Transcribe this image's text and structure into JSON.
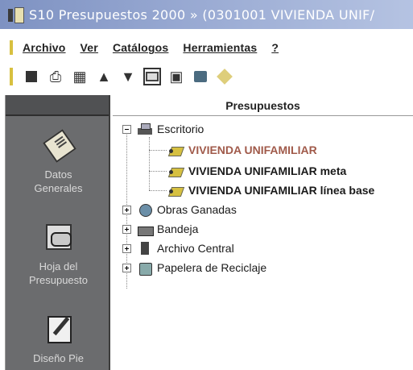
{
  "window": {
    "title": "S10 Presupuestos 2000 » (0301001 VIVIENDA UNIF/"
  },
  "menubar": {
    "items": [
      "Archivo",
      "Ver",
      "Catálogos",
      "Herramientas",
      "?"
    ]
  },
  "toolbar": {
    "buttons": [
      "save-icon",
      "print-icon",
      "print-preview-icon",
      "up-arrow-icon",
      "down-arrow-icon",
      "view-icon",
      "tile-icon",
      "calculator-icon",
      "tag-icon"
    ]
  },
  "sidebar": {
    "items": [
      {
        "label_line1": "Datos",
        "label_line2": "Generales",
        "icon": "notepad-icon"
      },
      {
        "label_line1": "Hoja del",
        "label_line2": "Presupuesto",
        "icon": "hand-sheet-icon"
      },
      {
        "label_line1": "Diseño Pie",
        "label_line2": "",
        "icon": "pencil-icon"
      }
    ]
  },
  "main": {
    "header": "Presupuestos",
    "tree": {
      "escritorio": "Escritorio",
      "children": [
        "VIVIENDA UNIFAMILIAR",
        "VIVIENDA UNIFAMILIAR meta",
        "VIVIENDA UNIFAMILIAR línea base"
      ],
      "obras": "Obras Ganadas",
      "bandeja": "Bandeja",
      "archivo": "Archivo Central",
      "papelera": "Papelera de Reciclaje"
    }
  },
  "colors": {
    "titlebar": "#8ea0cc",
    "sidebar": "#6b6c6e",
    "selected_text": "#a05a4a"
  }
}
